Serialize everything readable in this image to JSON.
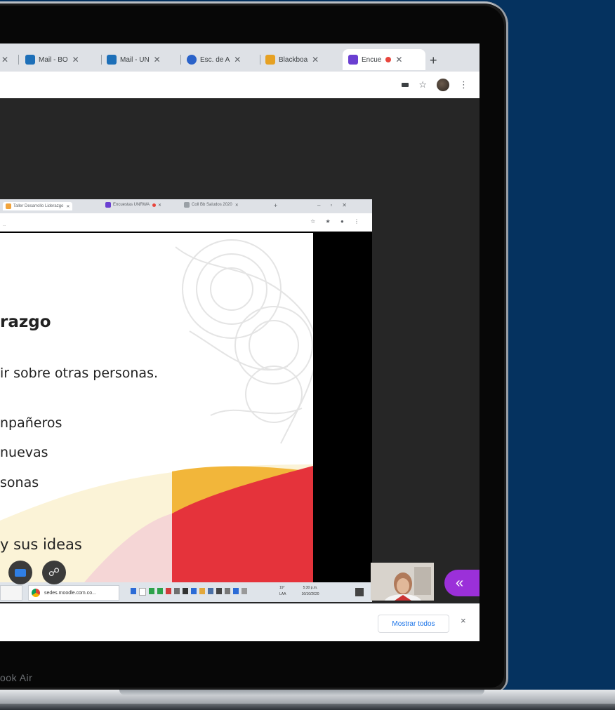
{
  "browser": {
    "tabs": [
      {
        "label": "",
        "icon": "page-icon",
        "color": "#f1a33b"
      },
      {
        "label": "Mail - BO",
        "icon": "outlook-icon",
        "color": "#1d6fb8"
      },
      {
        "label": "Mail - UN",
        "icon": "outlook-icon",
        "color": "#1d6fb8"
      },
      {
        "label": "Esc. de A",
        "icon": "school-icon",
        "color": "#2a62c9"
      },
      {
        "label": "Blackboa",
        "icon": "blackboard-icon",
        "color": "#e6a123"
      },
      {
        "label": "Encue",
        "icon": "collaborate-icon",
        "color": "#6a3fd1"
      }
    ],
    "new_tab_label": "+"
  },
  "shared_screen": {
    "inner_tabs": [
      "Taller Desarrollo Liderazgo",
      "Encuestas UNRWA",
      "Coll Bb Saludos 2020"
    ],
    "inner_url": "...",
    "slide": {
      "title_fragment": "razgo",
      "line1": "ir sobre otras personas.",
      "line2": "npañeros",
      "line3": "nuevas",
      "line4": "sonas",
      "line5": "y sus ideas"
    },
    "taskbar": {
      "app1": "",
      "app2": "sedes.moodle.com.co...",
      "weather": "19°",
      "time": "5:30 p.m.",
      "date": "16/10/2020",
      "lang": "LAA"
    }
  },
  "download_bar": {
    "show_all_label": "Mostrar todos",
    "close_label": "×"
  },
  "laptop": {
    "label": "ook Air"
  },
  "colors": {
    "collaborate_purple": "#9b30d9",
    "background_navy": "#05325f"
  }
}
